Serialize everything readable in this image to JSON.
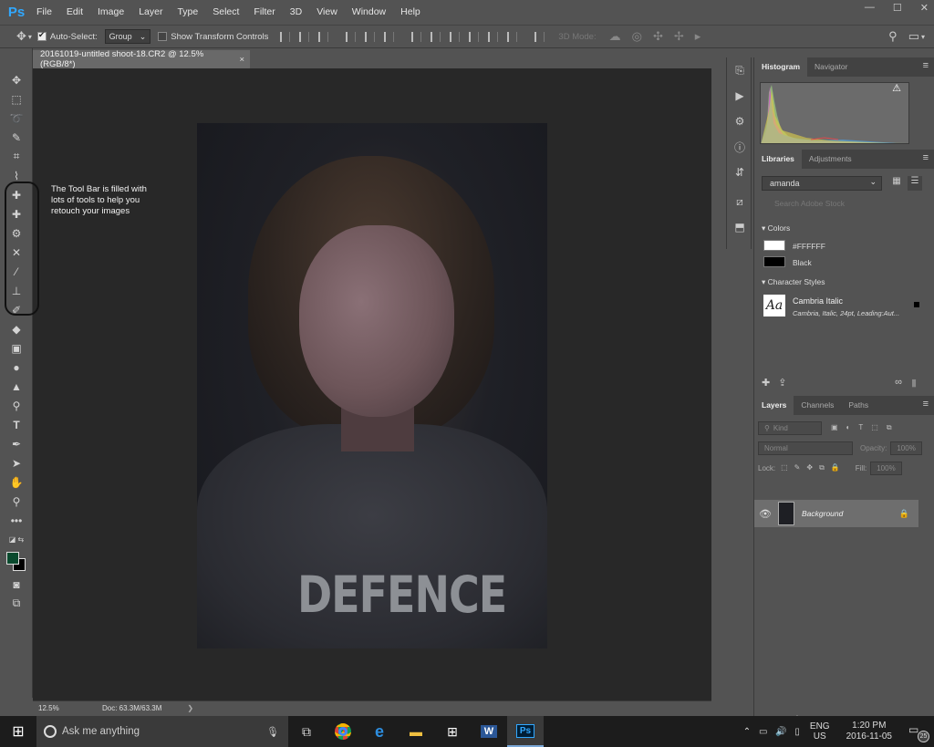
{
  "app": {
    "logo": "Ps"
  },
  "menu": [
    "File",
    "Edit",
    "Image",
    "Layer",
    "Type",
    "Select",
    "Filter",
    "3D",
    "View",
    "Window",
    "Help"
  ],
  "window_controls": [
    "—",
    "☐",
    "✕"
  ],
  "options": {
    "auto_select_label": "Auto-Select:",
    "auto_select_value": "Group",
    "transform_label": "Show Transform Controls",
    "mode_label": "3D Mode:"
  },
  "document": {
    "tab_title": "20161019-untitled shoot-18.CR2 @ 12.5% (RGB/8*)",
    "close": "×",
    "shirt_text": "DEFENCE"
  },
  "annotation": {
    "line1": "The Tool Bar is filled with",
    "line2": "lots of tools to help you",
    "line3": "retouch your images"
  },
  "status": {
    "zoom": "12.5%",
    "doc": "Doc: 63.3M/63.3M",
    "arrow": "❯"
  },
  "panels": {
    "histogram_tabs": [
      "Histogram",
      "Navigator"
    ],
    "libraries_tabs": [
      "Libraries",
      "Adjustments"
    ],
    "library_name": "amanda",
    "search_placeholder": "Search Adobe Stock",
    "colors_header": "Colors",
    "colors": [
      {
        "label": "#FFFFFF",
        "hex": "#FFFFFF"
      },
      {
        "label": "Black",
        "hex": "#000000"
      }
    ],
    "char_header": "Character Styles",
    "char_name": "Cambria Italic",
    "char_desc": "Cambria, Italic, 24pt, Leading:Aut...",
    "char_sample": "Aa",
    "layers_tabs": [
      "Layers",
      "Channels",
      "Paths"
    ],
    "kind": "Kind",
    "blend": "Normal",
    "opacity_label": "Opacity:",
    "opacity": "100%",
    "lock_label": "Lock:",
    "fill_label": "Fill:",
    "fill": "100%",
    "layer_name": "Background"
  },
  "taskbar": {
    "search": "Ask me anything",
    "lang1": "ENG",
    "lang2": "US",
    "time": "1:20 PM",
    "date": "2016-11-05",
    "notif_count": "25"
  }
}
